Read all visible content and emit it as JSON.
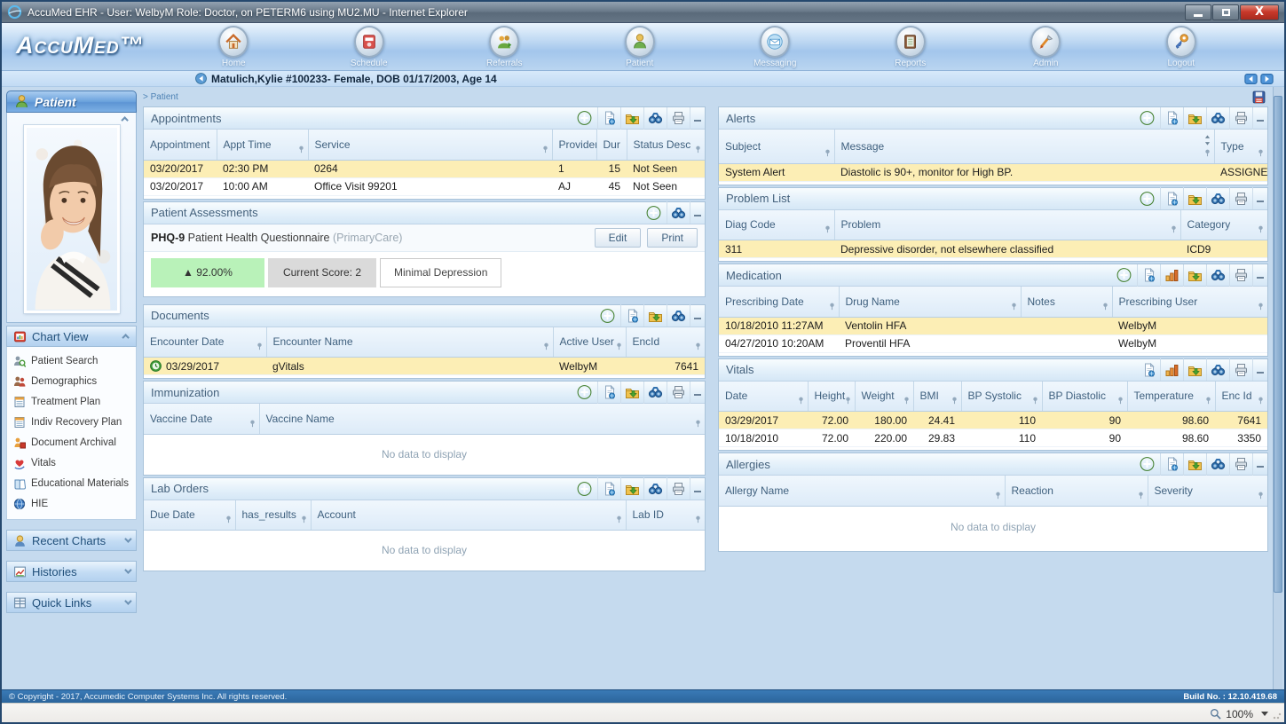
{
  "window": {
    "title": "AccuMed EHR - User: WelbyM Role: Doctor, on PETERM6 using MU2.MU - Internet Explorer",
    "brand": "AccuMed™"
  },
  "nav": {
    "items": [
      {
        "label": "Home"
      },
      {
        "label": "Schedule"
      },
      {
        "label": "Referrals"
      },
      {
        "label": "Patient"
      },
      {
        "label": "Messaging"
      },
      {
        "label": "Reports"
      },
      {
        "label": "Admin"
      },
      {
        "label": "Logout"
      }
    ]
  },
  "banner": {
    "text": "Matulich,Kylie #100233- Female, DOB 01/17/2003, Age 14"
  },
  "breadcrumb": {
    "text": "> Patient"
  },
  "sidebar": {
    "title": "Patient",
    "chart_view": {
      "label": "Chart View",
      "items": [
        "Patient Search",
        "Demographics",
        "Treatment Plan",
        "Indiv Recovery Plan",
        "Document Archival",
        "Vitals",
        "Educational Materials",
        "HIE"
      ]
    },
    "recent_charts": "Recent Charts",
    "histories": "Histories",
    "quick_links": "Quick Links"
  },
  "panels": {
    "appointments": {
      "title": "Appointments",
      "columns": [
        "Appointment",
        "Appt Time",
        "Service",
        "Provider",
        "Dur",
        "Status Desc"
      ],
      "rows": [
        [
          "03/20/2017",
          "02:30 PM",
          "0264",
          "1",
          "15",
          "Not Seen"
        ],
        [
          "03/20/2017",
          "10:00 AM",
          "Office Visit 99201",
          "AJ",
          "45",
          "Not Seen"
        ]
      ]
    },
    "assessments": {
      "title": "Patient Assessments",
      "instrument": "PHQ-9",
      "instrument_name": " Patient Health Questionnaire ",
      "program": "(PrimaryCare)",
      "edit_label": "Edit",
      "print_label": "Print",
      "trend": "▲ 92.00%",
      "current_score": "Current Score: 2",
      "severity": "Minimal Depression"
    },
    "documents": {
      "title": "Documents",
      "columns": [
        "Encounter Date",
        "Encounter Name",
        "Active User",
        "EncId"
      ],
      "rows": [
        [
          "03/29/2017",
          "gVitals",
          "WelbyM",
          "7641"
        ]
      ]
    },
    "immunization": {
      "title": "Immunization",
      "columns": [
        "Vaccine Date",
        "Vaccine Name"
      ],
      "empty": "No data to display"
    },
    "lab_orders": {
      "title": "Lab Orders",
      "columns": [
        "Due Date",
        "has_results",
        "Account",
        "Lab ID"
      ],
      "empty": "No data to display"
    },
    "alerts": {
      "title": "Alerts",
      "columns": [
        "Subject",
        "Message",
        "Type"
      ],
      "rows": [
        [
          "System Alert",
          "Diastolic is 90+, monitor for High BP.",
          "ASSIGNED"
        ]
      ]
    },
    "problem_list": {
      "title": "Problem List",
      "columns": [
        "Diag Code",
        "Problem",
        "Category"
      ],
      "rows": [
        [
          "311",
          "Depressive disorder, not elsewhere classified",
          "ICD9"
        ]
      ]
    },
    "medication": {
      "title": "Medication",
      "columns": [
        "Prescribing Date",
        "Drug Name",
        "Notes",
        "Prescribing User"
      ],
      "rows": [
        [
          "10/18/2010 11:27AM",
          "Ventolin HFA",
          "",
          "WelbyM"
        ],
        [
          "04/27/2010 10:20AM",
          "Proventil HFA",
          "",
          "WelbyM"
        ]
      ]
    },
    "vitals": {
      "title": "Vitals",
      "columns": [
        "Date",
        "Height",
        "Weight",
        "BMI",
        "BP Systolic",
        "BP Diastolic",
        "Temperature",
        "Enc Id"
      ],
      "rows": [
        [
          "03/29/2017",
          "72.00",
          "180.00",
          "24.41",
          "110",
          "90",
          "98.60",
          "7641"
        ],
        [
          "10/18/2010",
          "72.00",
          "220.00",
          "29.83",
          "110",
          "90",
          "98.60",
          "3350"
        ]
      ]
    },
    "allergies": {
      "title": "Allergies",
      "columns": [
        "Allergy Name",
        "Reaction",
        "Severity"
      ],
      "empty": "No data to display"
    }
  },
  "footer": {
    "copyright": "© Copyright - 2017, Accumedic Computer Systems Inc. All rights reserved.",
    "build": "Build No. : 12.10.419.68",
    "zoom": "100%"
  },
  "colors": {
    "row_highlight": "#fceeb5",
    "trend_green": "#b9f2b9",
    "header_gradient_blue": "#d5e7f6",
    "footer_blue": "#2b659c",
    "titlebar_gray": "#6b7b8b"
  }
}
